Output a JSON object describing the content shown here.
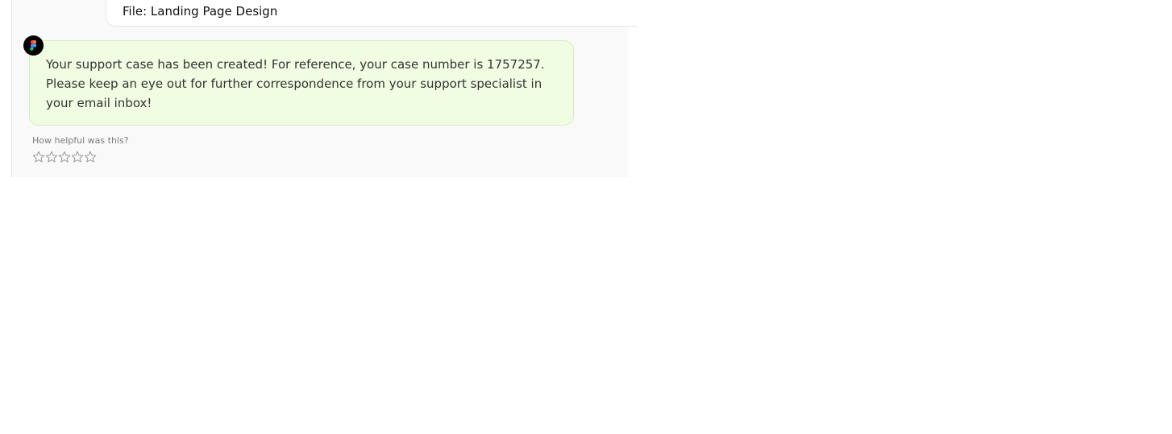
{
  "chat": {
    "user_message": {
      "text": "File: Landing Page Design"
    },
    "bot_message": {
      "avatar_icon": "figma-logo-icon",
      "text": "Your support case has been created! For reference, your case number is 1757257. Please keep an eye out for further correspondence from your support specialist in your email inbox!"
    },
    "feedback": {
      "prompt": "How helpful was this?",
      "rating": 0,
      "max_rating": 5,
      "star_icon": "star-outline-icon"
    }
  },
  "colors": {
    "panel_background": "#f9f9f9",
    "bot_bubble_background": "#f0fde3",
    "bot_bubble_border": "#d7ecc4",
    "user_bubble_background": "#ffffff",
    "star_outline": "#9a9a9a"
  }
}
